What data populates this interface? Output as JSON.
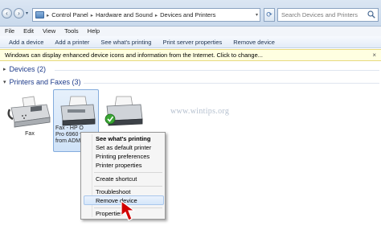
{
  "address_bar": {
    "crumbs": [
      "Control Panel",
      "Hardware and Sound",
      "Devices and Printers"
    ],
    "search_placeholder": "Search Devices and Printers"
  },
  "menu": [
    "File",
    "Edit",
    "View",
    "Tools",
    "Help"
  ],
  "command_bar": [
    "Add a device",
    "Add a printer",
    "See what's printing",
    "Print server properties",
    "Remove device"
  ],
  "info_bar": "Windows can display enhanced device icons and information from the Internet. Click to change...",
  "groups": {
    "devices": "Devices (2)",
    "printers": "Printers and Faxes (3)"
  },
  "devices": {
    "fax_label": "Fax",
    "selected_label_lines": [
      "Fax - HP O",
      "Pro 6960 v",
      "from ADM"
    ]
  },
  "context_menu": {
    "items": [
      "See what's printing",
      "Set as default printer",
      "Printing preferences",
      "Printer properties",
      "Create shortcut",
      "Troubleshoot",
      "Remove device",
      "Properties"
    ],
    "highlighted": "Remove device"
  },
  "watermark": "www.wintips.org",
  "colors": {
    "accent": "#1e3b8a",
    "selection": "#cfe2f8",
    "info_bar": "#ffffe1",
    "arrow": "#d10000",
    "check": "#3aa534"
  }
}
